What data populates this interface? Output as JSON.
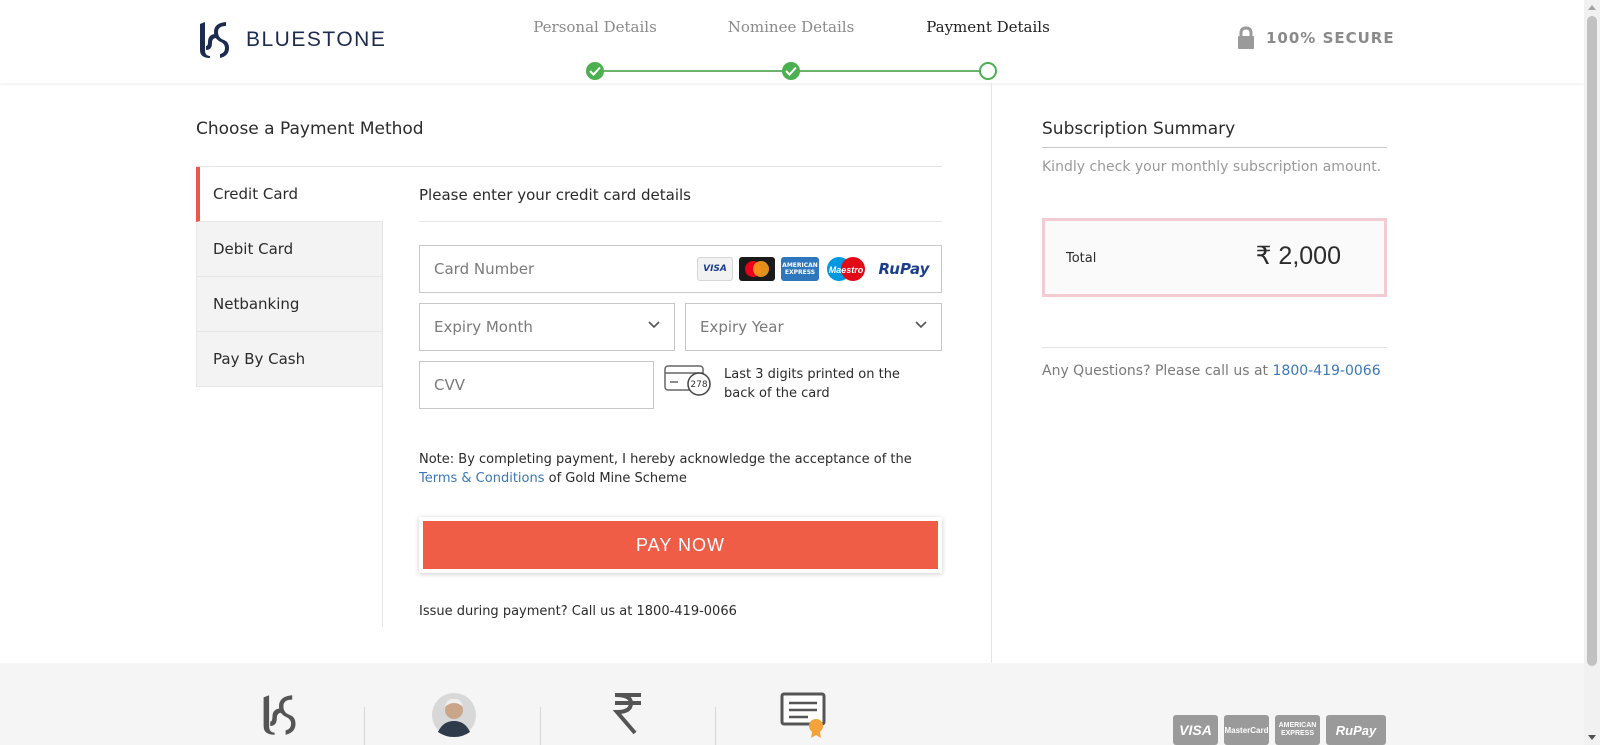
{
  "brand": {
    "name": "BLUESTONE"
  },
  "steps": [
    {
      "label": "Personal Details",
      "state": "done"
    },
    {
      "label": "Nominee Details",
      "state": "done"
    },
    {
      "label": "Payment Details",
      "state": "current"
    }
  ],
  "secure": {
    "icon": "lock-icon",
    "label": "100% SECURE"
  },
  "payment": {
    "title": "Choose a Payment Method",
    "methods": [
      "Credit Card",
      "Debit Card",
      "Netbanking",
      "Pay By Cash"
    ],
    "active_method": "Credit Card",
    "form_title": "Please enter your credit card details",
    "card_number_placeholder": "Card Number",
    "card_logos": [
      "VISA",
      "MasterCard",
      "AMERICAN EXPRESS",
      "Maestro",
      "RuPay"
    ],
    "expiry_month_placeholder": "Expiry Month",
    "expiry_year_placeholder": "Expiry Year",
    "cvv_placeholder": "CVV",
    "cvv_example": "278",
    "cvv_hint": "Last 3 digits printed on the back of the card",
    "note_prefix": "Note: By completing payment, I hereby acknowledge the acceptance of the",
    "terms_link": "Terms & Conditions",
    "note_suffix": "of Gold Mine Scheme",
    "pay_button": "PAY NOW",
    "issue_text": "Issue during payment? Call us at 1800-419-0066"
  },
  "summary": {
    "title": "Subscription Summary",
    "subtitle": "Kindly check your monthly subscription amount.",
    "total_label": "Total",
    "total_value": "₹ 2,000",
    "questions_prefix": "Any Questions? Please call us at",
    "phone": "1800-419-0066"
  },
  "footer": {
    "icons": [
      "bluestone-logo-icon",
      "founder-portrait-icon",
      "rupee-icon",
      "certificate-icon"
    ],
    "cards": [
      "VISA",
      "MasterCard",
      "AMERICAN EXPRESS",
      "RuPay"
    ]
  },
  "colors": {
    "accent": "#f05d46",
    "success": "#4caf50",
    "link": "#3a78b8",
    "total_border": "#f4cbd2"
  }
}
